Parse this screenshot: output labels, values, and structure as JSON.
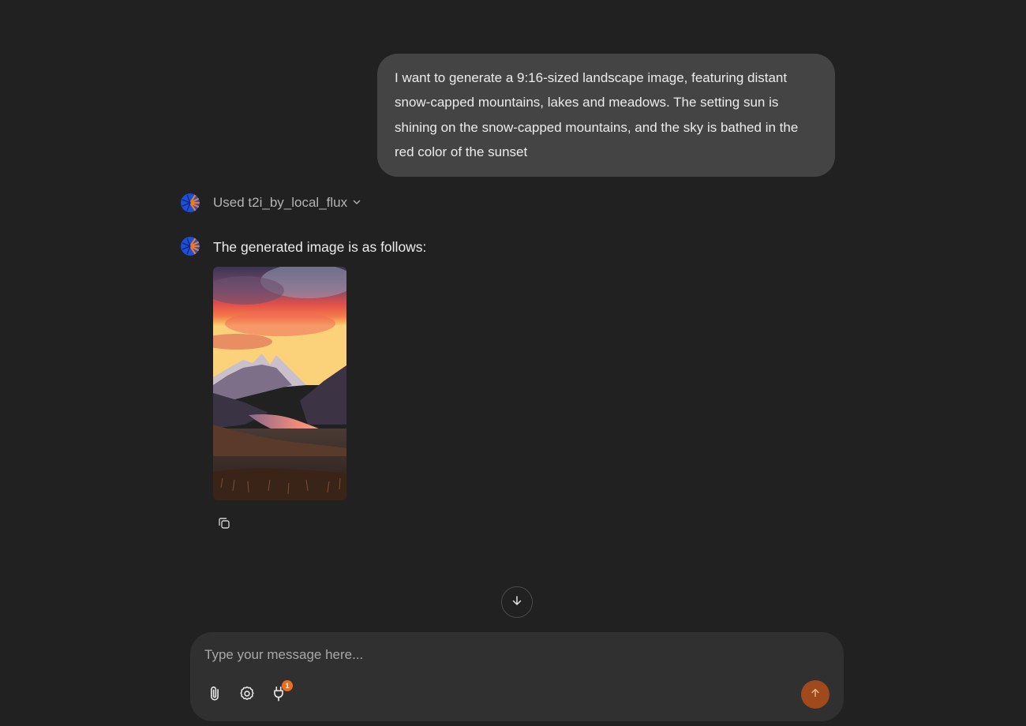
{
  "conversation": {
    "user_message": "I want to generate a 9:16-sized landscape image, featuring distant snow-capped mountains, lakes and meadows. The setting sun is shining on the snow-capped mountains, and the sky is bathed in the red color of the sunset",
    "tool_used_label": "Used t2i_by_local_flux",
    "assistant_reply": "The generated image is as follows:"
  },
  "composer": {
    "placeholder": "Type your message here...",
    "plugin_badge_count": "1"
  },
  "icons": {
    "avatar": "assistant-avatar-icon",
    "expand": "chevron-down-icon",
    "copy": "copy-icon",
    "scroll": "arrow-down-icon",
    "attach": "paperclip-icon",
    "settings": "gear-icon",
    "plugin": "plug-icon",
    "send": "arrow-up-icon"
  },
  "colors": {
    "background": "#212121",
    "user_bubble": "#444444",
    "composer": "#303030",
    "send_button": "#a0491c",
    "badge": "#f26b1d"
  }
}
